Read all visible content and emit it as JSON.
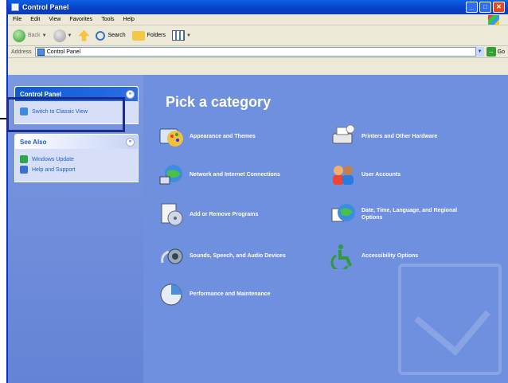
{
  "window": {
    "title": "Control Panel"
  },
  "menu": [
    "File",
    "Edit",
    "View",
    "Favorites",
    "Tools",
    "Help"
  ],
  "toolbar": {
    "back": "Back",
    "search": "Search",
    "folders": "Folders"
  },
  "address": {
    "label": "Address",
    "value": "Control Panel",
    "go": "Go"
  },
  "sidebar": {
    "control_panel_title": "Control Panel",
    "switch_view": "Switch to Classic View",
    "see_also_title": "See Also",
    "see_also_items": [
      "Windows Update",
      "Help and Support"
    ]
  },
  "main": {
    "heading": "Pick a category",
    "categories": [
      {
        "label": "Appearance and Themes",
        "icon": "appearance-icon"
      },
      {
        "label": "Printers and Other Hardware",
        "icon": "printer-icon"
      },
      {
        "label": "Network and Internet Connections",
        "icon": "network-icon"
      },
      {
        "label": "User Accounts",
        "icon": "users-icon"
      },
      {
        "label": "Add or Remove Programs",
        "icon": "programs-icon"
      },
      {
        "label": "Date, Time, Language, and Regional Options",
        "icon": "globe-clock-icon"
      },
      {
        "label": "Sounds, Speech, and Audio Devices",
        "icon": "audio-icon"
      },
      {
        "label": "Accessibility Options",
        "icon": "accessibility-icon"
      },
      {
        "label": "Performance and Maintenance",
        "icon": "performance-icon"
      }
    ]
  },
  "colors": {
    "titlebar": "#0a5fe0",
    "main_bg": "#6f8fdf",
    "sidebar_bg": "#7b98e0",
    "highlight": "#1c2a8a"
  }
}
